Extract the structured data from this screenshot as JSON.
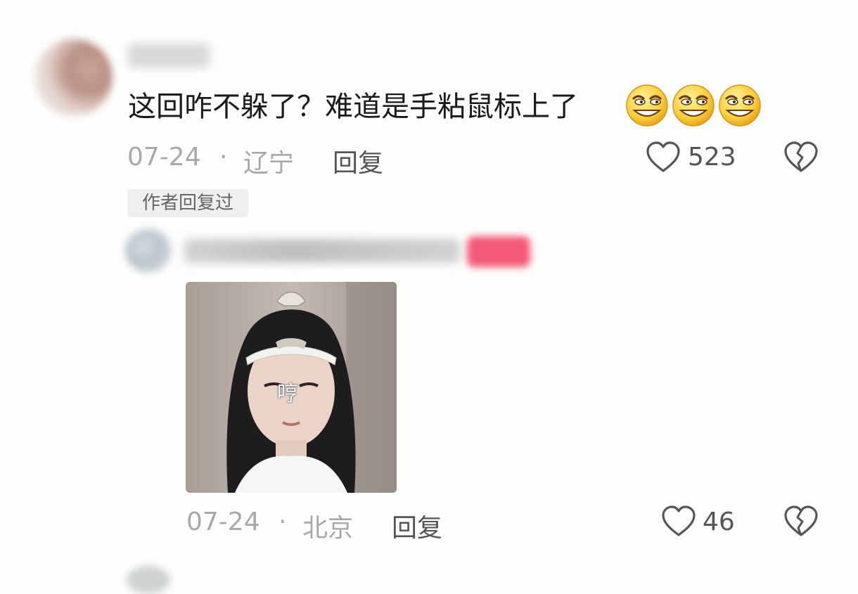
{
  "comment": {
    "text": "这回咋不躲了？难道是手粘鼠标上了",
    "emojis": [
      "grin-emoji",
      "grin-emoji",
      "grin-emoji"
    ],
    "date": "07-24",
    "separator": "·",
    "location": "辽宁",
    "reply_label": "回复",
    "likes": "523",
    "author_replied_tag": "作者回复过"
  },
  "reply": {
    "sticker_caption": "哼",
    "date": "07-24",
    "separator": "·",
    "location": "北京",
    "reply_label": "回复",
    "likes": "46"
  },
  "colors": {
    "background": "#fdfdfb",
    "meta_text": "#a9a9a9",
    "reply_text": "#555555",
    "author_badge": "#f25a78",
    "tag_background": "#efefef"
  }
}
